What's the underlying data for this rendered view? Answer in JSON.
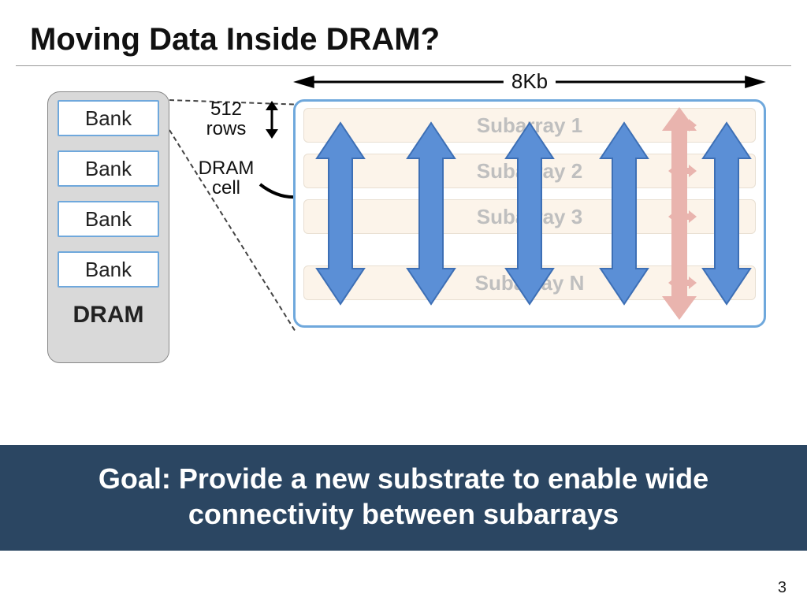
{
  "title": "Moving Data Inside DRAM?",
  "dram": {
    "label": "DRAM",
    "banks": [
      "Bank",
      "Bank",
      "Bank",
      "Bank"
    ]
  },
  "annotations": {
    "rows": "512 rows",
    "cell": "DRAM cell",
    "width": "8Kb"
  },
  "subarrays": [
    "Subarray 1",
    "Subarray 2",
    "Subarray 3",
    "Subarray N"
  ],
  "goal": "Goal: Provide a new substrate to enable wide connectivity between subarrays",
  "page": "3"
}
